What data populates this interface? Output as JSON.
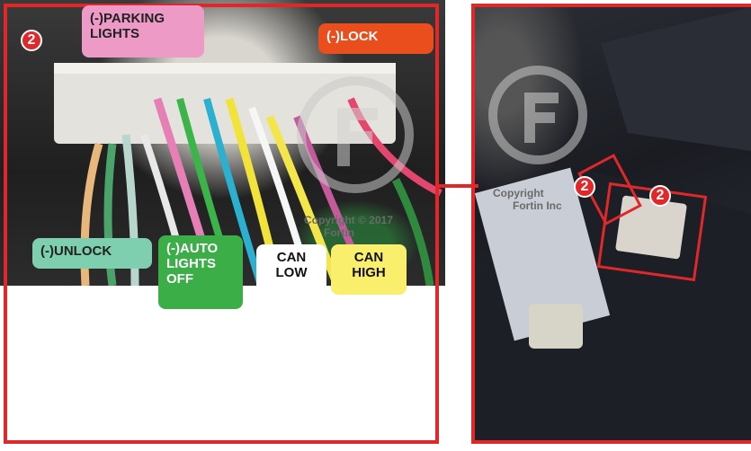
{
  "badges": {
    "main": "2",
    "right_small": "2",
    "right_large": "2"
  },
  "labels": {
    "parking_line1": "(-)PARKING",
    "parking_line2": "LIGHTS",
    "lock": "(-)LOCK",
    "unlock": "(-)UNLOCK",
    "auto_line1": "(-)AUTO",
    "auto_line2": "LIGHTS",
    "auto_line3": "OFF",
    "canlow_line1": "CAN",
    "canlow_line2": "LOW",
    "canhigh_line1": "CAN",
    "canhigh_line2": "HIGH"
  },
  "watermark": {
    "left_line1": "Copyright © 2017",
    "left_line2": "Fortin",
    "right_line1": "Copyright",
    "right_line2": "Fortin Inc"
  },
  "colors": {
    "frame": "#e0282b",
    "parking": "#ee9ac6",
    "lock": "#eb4e1d",
    "unlock": "#7ecfb0",
    "autolights": "#3cae48",
    "canlow": "#ffffff",
    "canhigh": "#f9ef6c"
  }
}
